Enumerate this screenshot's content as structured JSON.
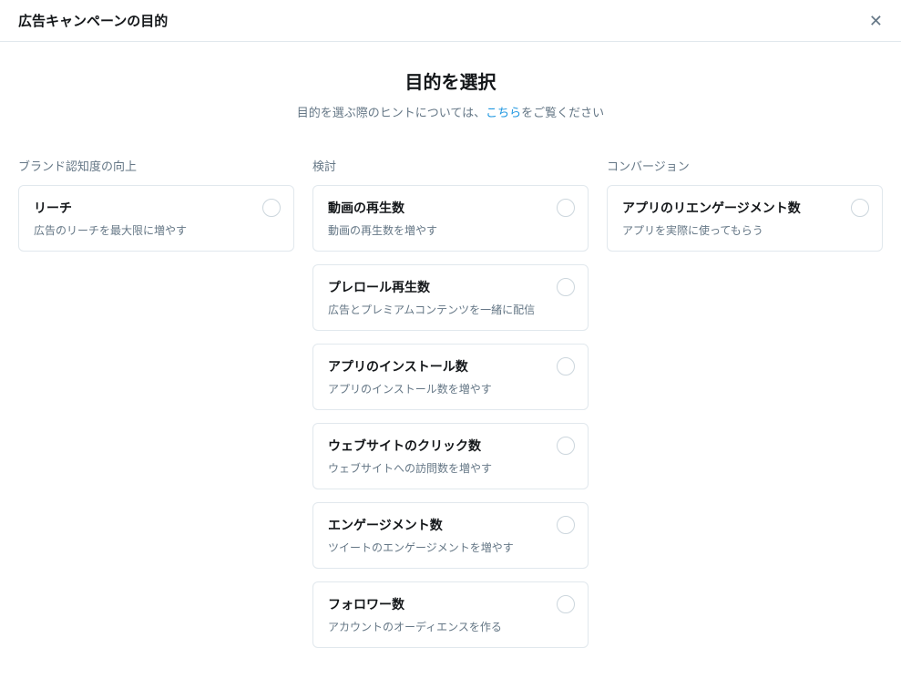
{
  "header": {
    "title": "広告キャンペーンの目的"
  },
  "intro": {
    "title": "目的を選択",
    "sub_prefix": "目的を選ぶ際のヒントについては、",
    "link_text": "こちら",
    "sub_suffix": "をご覧ください"
  },
  "columns": [
    {
      "header": "ブランド認知度の向上",
      "options": [
        {
          "title": "リーチ",
          "desc": "広告のリーチを最大限に増やす"
        }
      ]
    },
    {
      "header": "検討",
      "options": [
        {
          "title": "動画の再生数",
          "desc": "動画の再生数を増やす"
        },
        {
          "title": "プレロール再生数",
          "desc": "広告とプレミアムコンテンツを一緒に配信"
        },
        {
          "title": "アプリのインストール数",
          "desc": "アプリのインストール数を増やす"
        },
        {
          "title": "ウェブサイトのクリック数",
          "desc": "ウェブサイトへの訪問数を増やす"
        },
        {
          "title": "エンゲージメント数",
          "desc": "ツイートのエンゲージメントを増やす"
        },
        {
          "title": "フォロワー数",
          "desc": "アカウントのオーディエンスを作る"
        }
      ]
    },
    {
      "header": "コンバージョン",
      "options": [
        {
          "title": "アプリのリエンゲージメント数",
          "desc": "アプリを実際に使ってもらう"
        }
      ]
    }
  ]
}
